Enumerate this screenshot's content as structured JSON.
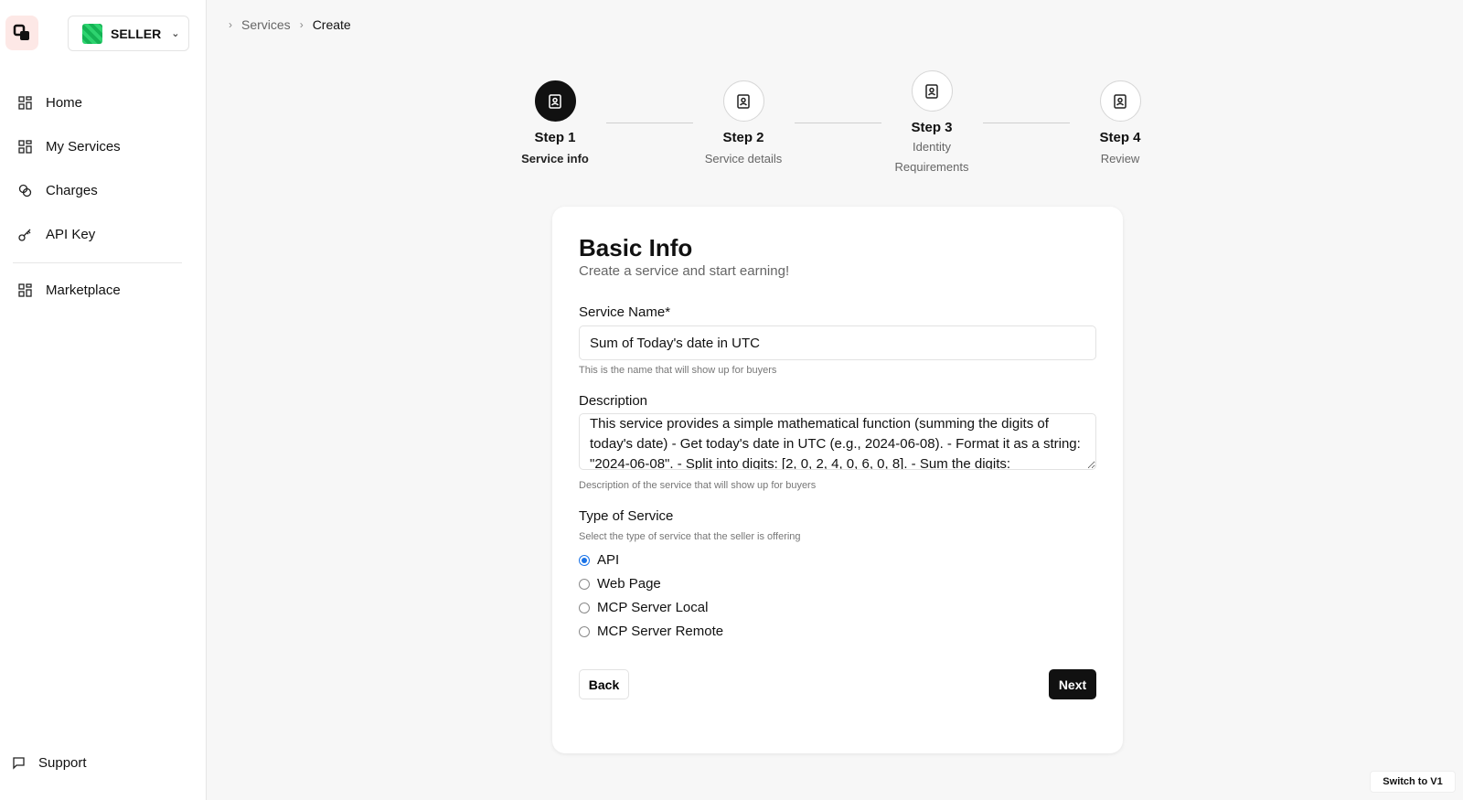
{
  "sidebar": {
    "role": "SELLER",
    "items": [
      {
        "label": "Home",
        "icon": "grid-icon"
      },
      {
        "label": "My Services",
        "icon": "grid-icon"
      },
      {
        "label": "Charges",
        "icon": "coins-icon"
      },
      {
        "label": "API Key",
        "icon": "key-icon"
      }
    ],
    "secondary_items": [
      {
        "label": "Marketplace",
        "icon": "grid-icon"
      }
    ],
    "support_label": "Support"
  },
  "breadcrumb": [
    "Services",
    "Create"
  ],
  "stepper": [
    {
      "title": "Step 1",
      "subtitle": "Service info",
      "active": true
    },
    {
      "title": "Step 2",
      "subtitle": "Service details",
      "active": false
    },
    {
      "title": "Step 3",
      "subtitle": "Identity Requirements",
      "active": false
    },
    {
      "title": "Step 4",
      "subtitle": "Review",
      "active": false
    }
  ],
  "form": {
    "title": "Basic Info",
    "subtitle": "Create a service and start earning!",
    "service_name": {
      "label": "Service Name*",
      "value": "Sum of Today's date in UTC",
      "hint": "This is the name that will show up for buyers"
    },
    "description": {
      "label": "Description",
      "value": "This service provides a simple mathematical function (summing the digits of today's date) - Get today's date in UTC (e.g., 2024-06-08). - Format it as a string: \"2024-06-08\". - Split into digits: [2, 0, 2, 4, 0, 6, 0, 8]. - Sum the digits:",
      "hint": "Description of the service that will show up for buyers"
    },
    "service_type": {
      "label": "Type of Service",
      "hint": "Select the type of service that the seller is offering",
      "options": [
        "API",
        "Web Page",
        "MCP Server Local",
        "MCP Server Remote"
      ],
      "selected": "API"
    },
    "back_label": "Back",
    "next_label": "Next"
  },
  "switch_label": "Switch to V1",
  "colors": {
    "accent": "#111111",
    "radio": "#1a73e8",
    "logo_bg": "#fde8e6"
  }
}
